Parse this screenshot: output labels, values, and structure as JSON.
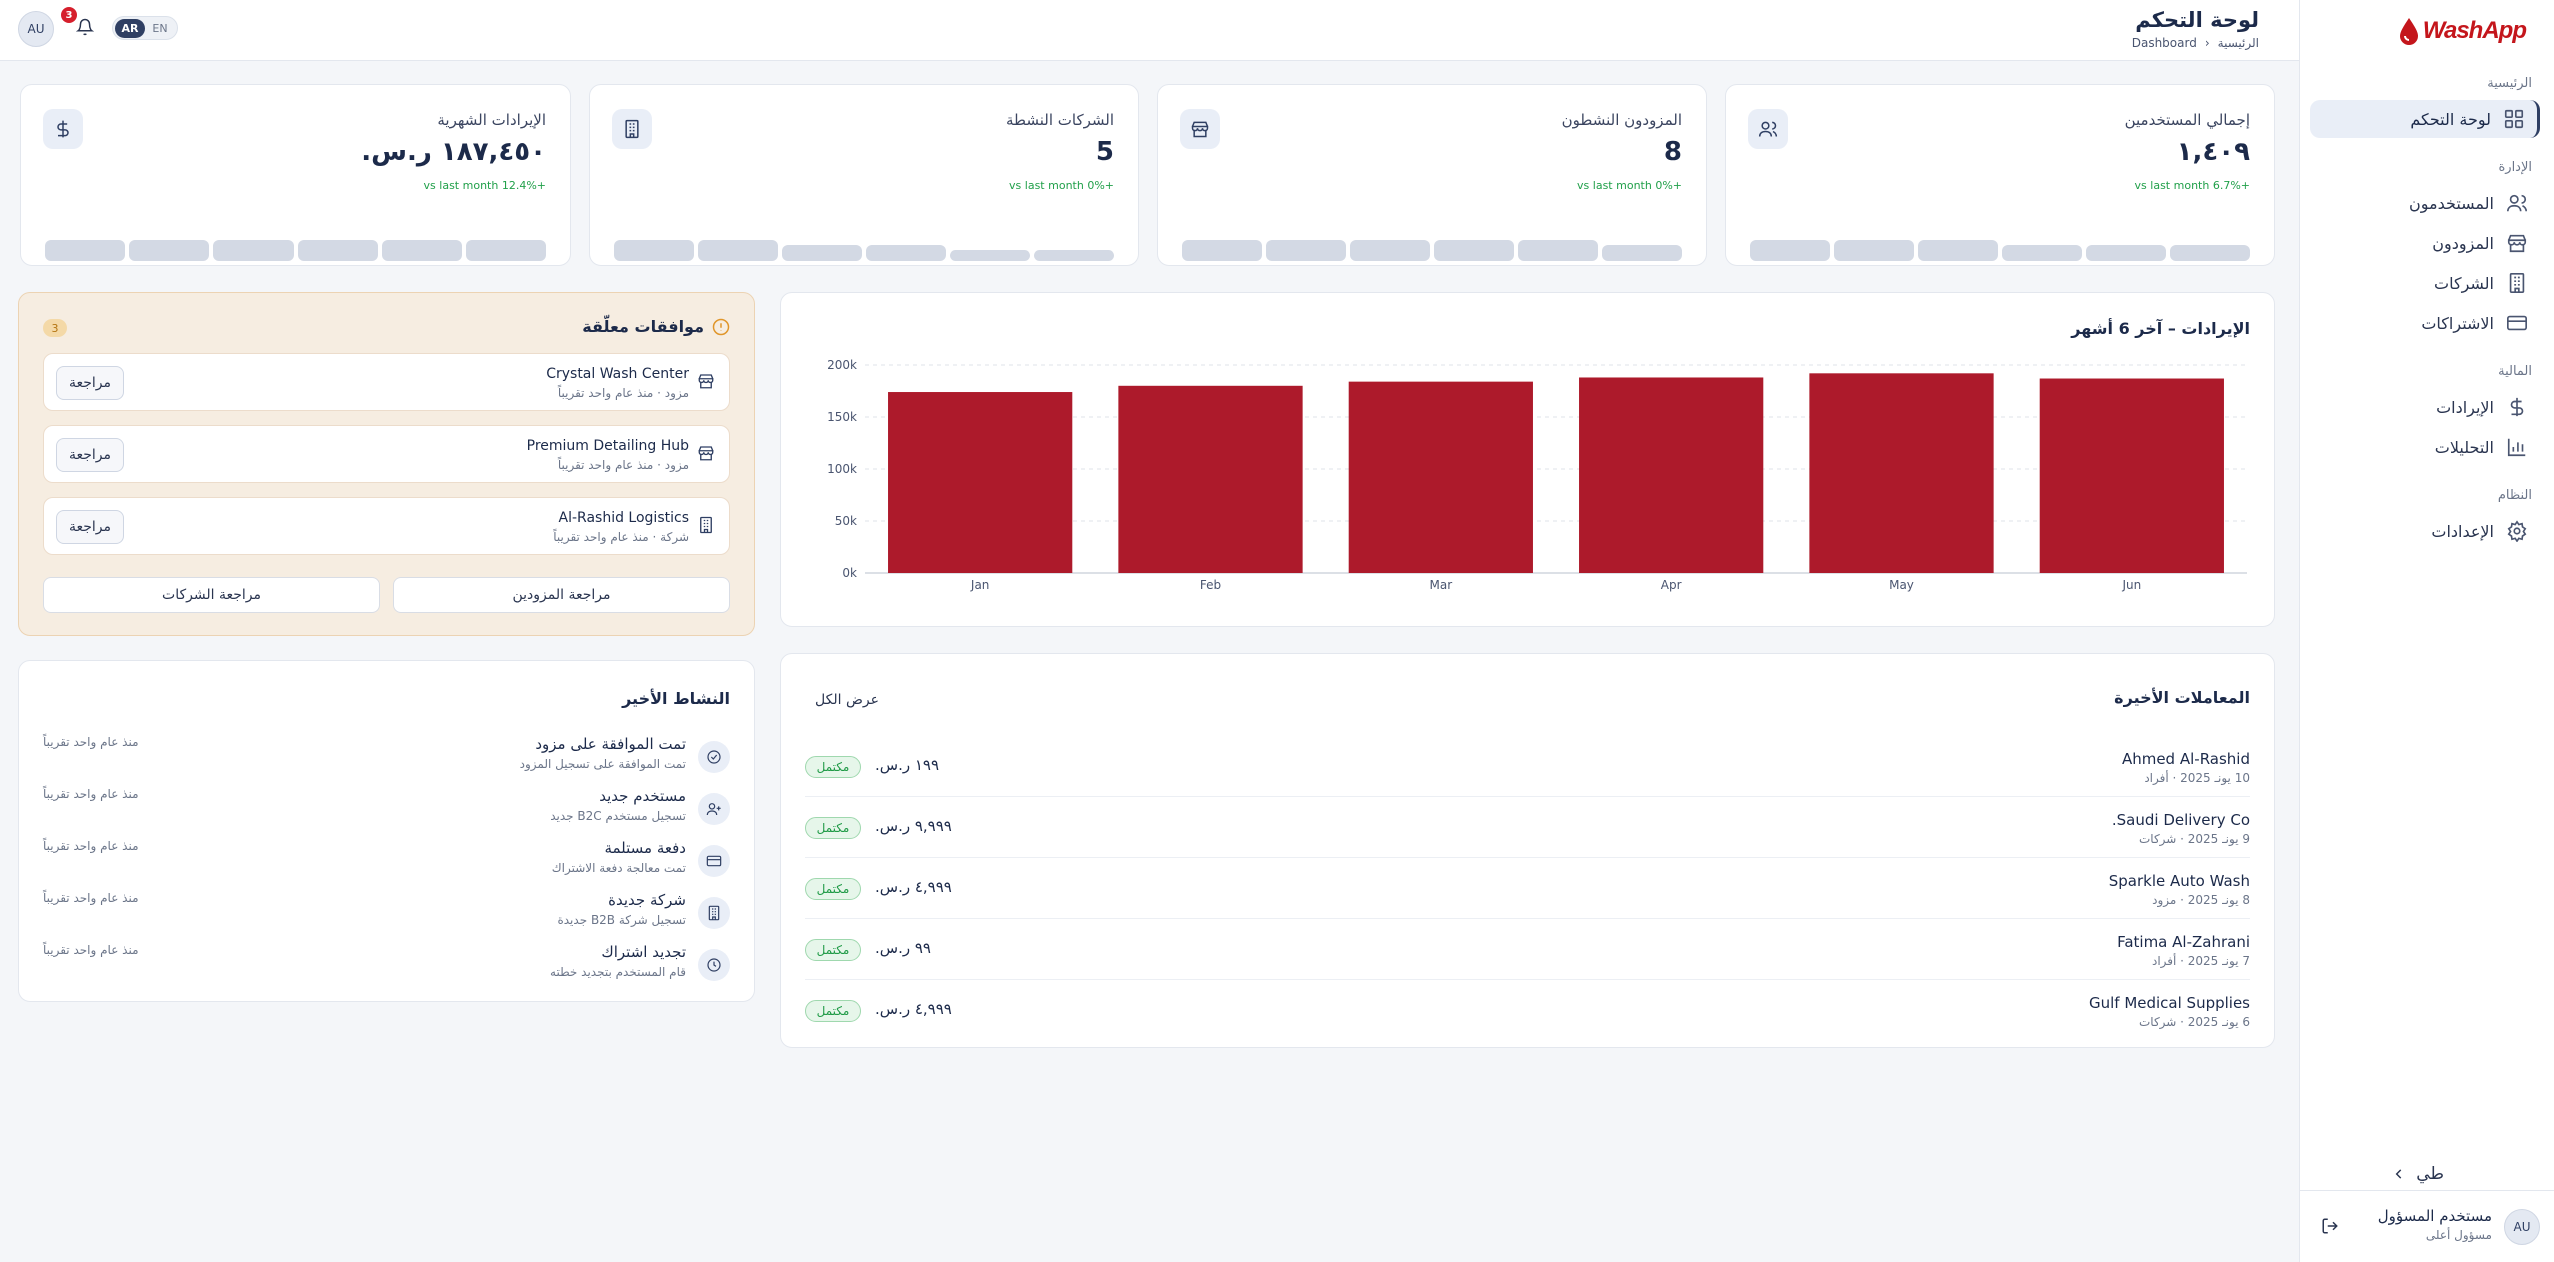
{
  "brand": {
    "logo_text": "WashApp",
    "accent": "#c4161c"
  },
  "sidebar": {
    "groups": {
      "main": "الرئيسية",
      "management": "الإدارة",
      "finance": "المالية",
      "system": "النظام"
    },
    "items": [
      {
        "label": "لوحة التحكم",
        "icon": "dashboard-icon"
      },
      {
        "label": "المستخدمون",
        "icon": "users-icon"
      },
      {
        "label": "المزودون",
        "icon": "store-icon"
      },
      {
        "label": "الشركات",
        "icon": "building-icon"
      },
      {
        "label": "الاشتراكات",
        "icon": "card-icon"
      },
      {
        "label": "الإيرادات",
        "icon": "dollar-icon"
      },
      {
        "label": "التحليلات",
        "icon": "chart-icon"
      },
      {
        "label": "الإعدادات",
        "icon": "gear-icon"
      }
    ],
    "collapse_label": "طي",
    "user": {
      "initials": "AU",
      "name": "مستخدم المسؤول",
      "role": "مسؤول أعلى"
    }
  },
  "topbar": {
    "title": "لوحة التحكم",
    "breadcrumb": {
      "home": "الرئيسية",
      "current": "Dashboard"
    },
    "lang": {
      "ar": "AR",
      "en": "EN"
    },
    "notifications": "3",
    "avatar": "AU"
  },
  "kpis": [
    {
      "label": "إجمالي المستخدمين",
      "value": "١,٤٠٩",
      "delta": "+6.7% vs last month",
      "spark": [
        0.62,
        0.62,
        0.62,
        0.48,
        0.48,
        0.48
      ]
    },
    {
      "label": "المزودون النشطون",
      "value": "8",
      "delta": "+0% vs last month",
      "spark": [
        0.62,
        0.62,
        0.62,
        0.62,
        0.62,
        0.48
      ]
    },
    {
      "label": "الشركات النشطة",
      "value": "5",
      "delta": "+0% vs last month",
      "spark": [
        0.62,
        0.62,
        0.48,
        0.48,
        0.32,
        0.32
      ]
    },
    {
      "label": "الإيرادات الشهرية",
      "value": "١٨٧,٤٥٠ ر.س.",
      "delta": "+12.4% vs last month",
      "spark": [
        0.62,
        0.62,
        0.62,
        0.62,
        0.62,
        0.62
      ]
    }
  ],
  "revenue_card": {
    "title": "الإيرادات – آخر 6 أشهر"
  },
  "chart_data": {
    "type": "bar",
    "categories": [
      "Jan",
      "Feb",
      "Mar",
      "Apr",
      "May",
      "Jun"
    ],
    "values": [
      174000,
      180000,
      184000,
      188000,
      192000,
      187000
    ],
    "y_ticks": [
      "0k",
      "50k",
      "100k",
      "150k",
      "200k"
    ],
    "ylim": [
      0,
      200000
    ],
    "color": "#ad1a2b",
    "grid": true
  },
  "pending": {
    "title": "موافقات معلّقة",
    "count": "3",
    "rows": [
      {
        "name": "Crystal Wash Center",
        "sub": "مزود · منذ عام واحد تقريباً",
        "icon": "store-icon",
        "action": "مراجعة"
      },
      {
        "name": "Premium Detailing Hub",
        "sub": "مزود · منذ عام واحد تقريباً",
        "icon": "store-icon",
        "action": "مراجعة"
      },
      {
        "name": "Al-Rashid Logistics",
        "sub": "شركة · منذ عام واحد تقريباً",
        "icon": "building-icon",
        "action": "مراجعة"
      }
    ],
    "review_providers": "مراجعة المزودين",
    "review_companies": "مراجعة الشركات"
  },
  "transactions": {
    "title": "المعاملات الأخيرة",
    "view_all": "عرض الكل",
    "rows": [
      {
        "name": "Ahmed Al-Rashid",
        "sub": "10 يونـ 2025 · أفراد",
        "amount": "١٩٩ ر.س.",
        "status": "مكتمل"
      },
      {
        "name": "Saudi Delivery Co.",
        "sub": "9 يونـ 2025 · شركات",
        "amount": "٩,٩٩٩ ر.س.",
        "status": "مكتمل"
      },
      {
        "name": "Sparkle Auto Wash",
        "sub": "8 يونـ 2025 · مزود",
        "amount": "٤,٩٩٩ ر.س.",
        "status": "مكتمل"
      },
      {
        "name": "Fatima Al-Zahrani",
        "sub": "7 يونـ 2025 · أفراد",
        "amount": "٩٩ ر.س.",
        "status": "مكتمل"
      },
      {
        "name": "Gulf Medical Supplies",
        "sub": "6 يونـ 2025 · شركات",
        "amount": "٤,٩٩٩ ر.س.",
        "status": "مكتمل"
      }
    ]
  },
  "activity": {
    "title": "النشاط الأخير",
    "rows": [
      {
        "title": "تمت الموافقة على مزود",
        "sub": "تمت الموافقة على تسجيل المزود",
        "time": "منذ عام واحد تقريباً",
        "icon": "check-circle-icon"
      },
      {
        "title": "مستخدم جديد",
        "sub": "تسجيل مستخدم B2C جديد",
        "time": "منذ عام واحد تقريباً",
        "icon": "user-plus-icon"
      },
      {
        "title": "دفعة مستلمة",
        "sub": "تمت معالجة دفعة الاشتراك",
        "time": "منذ عام واحد تقريباً",
        "icon": "card-icon"
      },
      {
        "title": "شركة جديدة",
        "sub": "تسجيل شركة B2B جديدة",
        "time": "منذ عام واحد تقريباً",
        "icon": "building-icon"
      },
      {
        "title": "تجديد اشتراك",
        "sub": "قام المستخدم بتجديد خطته",
        "time": "منذ عام واحد تقريباً",
        "icon": "clock-icon"
      }
    ]
  }
}
